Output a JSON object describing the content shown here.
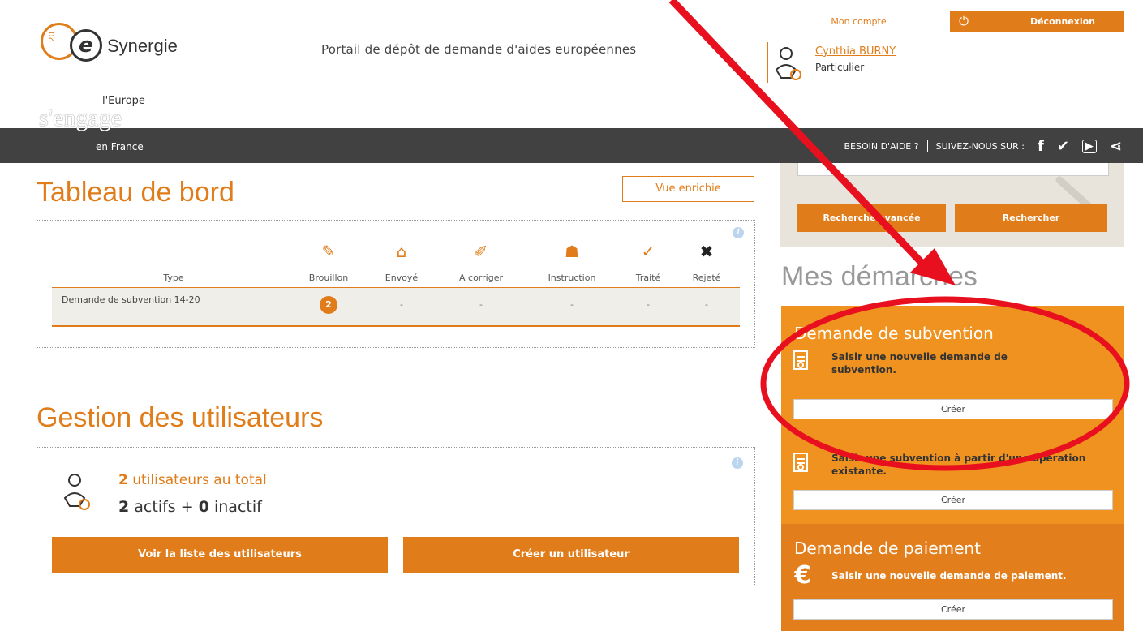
{
  "header": {
    "logo_text": "Synergie",
    "logo_number": "20",
    "portal_title": "Portail de dépôt de demande d'aides européennes",
    "account_label": "Mon compte",
    "logout_label": "Déconnexion",
    "user_name": "Cynthia  BURNY",
    "user_role": "Particulier",
    "europe_small": "l'Europe",
    "europe_big": "s'engage",
    "europe_country": "en France",
    "help_label": "BESOIN D'AIDE ?",
    "follow_label": "SUIVEZ-NOUS SUR :"
  },
  "dashboard": {
    "title": "Tableau de bord",
    "enriched_view_label": "Vue enrichie",
    "type_header": "Type",
    "columns": [
      "Brouillon",
      "Envoyé",
      "A corriger",
      "Instruction",
      "Traité",
      "Rejeté"
    ],
    "row": {
      "type": "Demande de subvention 14-20",
      "values": [
        "2",
        "-",
        "-",
        "-",
        "-",
        "-"
      ]
    },
    "info": "i"
  },
  "users": {
    "title": "Gestion des utilisateurs",
    "total_count": "2",
    "total_label": "utilisateurs au total",
    "active_count": "2",
    "active_label": "actifs +",
    "inactive_count": "0",
    "inactive_label": "inactif",
    "list_button": "Voir la liste des utilisateurs",
    "create_button": "Créer un utilisateur",
    "info": "i"
  },
  "search": {
    "advanced_label": "Recherche avancée",
    "search_label": "Rechercher"
  },
  "demarches": {
    "title": "Mes démarches",
    "subvention_title": "Demande de subvention",
    "new_subvention_text": "Saisir une nouvelle demande de subvention.",
    "create_label": "Créer",
    "from_existing_text": "Saisir une subvention à partir d'une opération existante.",
    "payment_title": "Demande de paiement",
    "new_payment_text": "Saisir une nouvelle demande de paiement."
  },
  "colors": {
    "accent": "#e07d1a",
    "panel": "#f0921f",
    "annotation": "#e8101e"
  }
}
